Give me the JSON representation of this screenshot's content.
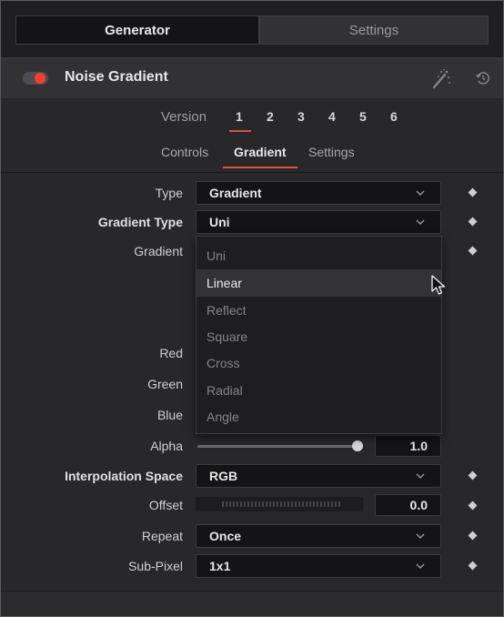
{
  "top_tabs": {
    "generator": "Generator",
    "settings": "Settings"
  },
  "header": {
    "title": "Noise Gradient",
    "icons": [
      "toggle-switch",
      "magic-wand-icon",
      "reset-icon"
    ]
  },
  "version": {
    "label": "Version",
    "numbers": [
      "1",
      "2",
      "3",
      "4",
      "5",
      "6"
    ],
    "active": "1"
  },
  "sub_tabs": {
    "controls": "Controls",
    "gradient": "Gradient",
    "settings": "Settings",
    "active": "Gradient"
  },
  "fields": {
    "type": {
      "label": "Type",
      "value": "Gradient"
    },
    "gradient_type": {
      "label": "Gradient Type",
      "value": "Uni"
    },
    "gradient": {
      "label": "Gradient"
    },
    "red": {
      "label": "Red"
    },
    "green": {
      "label": "Green"
    },
    "blue": {
      "label": "Blue"
    },
    "alpha": {
      "label": "Alpha",
      "value": "1.0"
    },
    "interpolation_space": {
      "label": "Interpolation Space",
      "value": "RGB"
    },
    "offset": {
      "label": "Offset",
      "value": "0.0"
    },
    "repeat": {
      "label": "Repeat",
      "value": "Once"
    },
    "sub_pixel": {
      "label": "Sub-Pixel",
      "value": "1x1"
    }
  },
  "dropdown_options": [
    "Uni",
    "Linear",
    "Reflect",
    "Square",
    "Cross",
    "Radial",
    "Angle"
  ],
  "dropdown_hover": "Linear",
  "colors": {
    "accent": "#d9533e",
    "toggle_on": "#ff3b30",
    "panel_bg": "#28282b"
  }
}
